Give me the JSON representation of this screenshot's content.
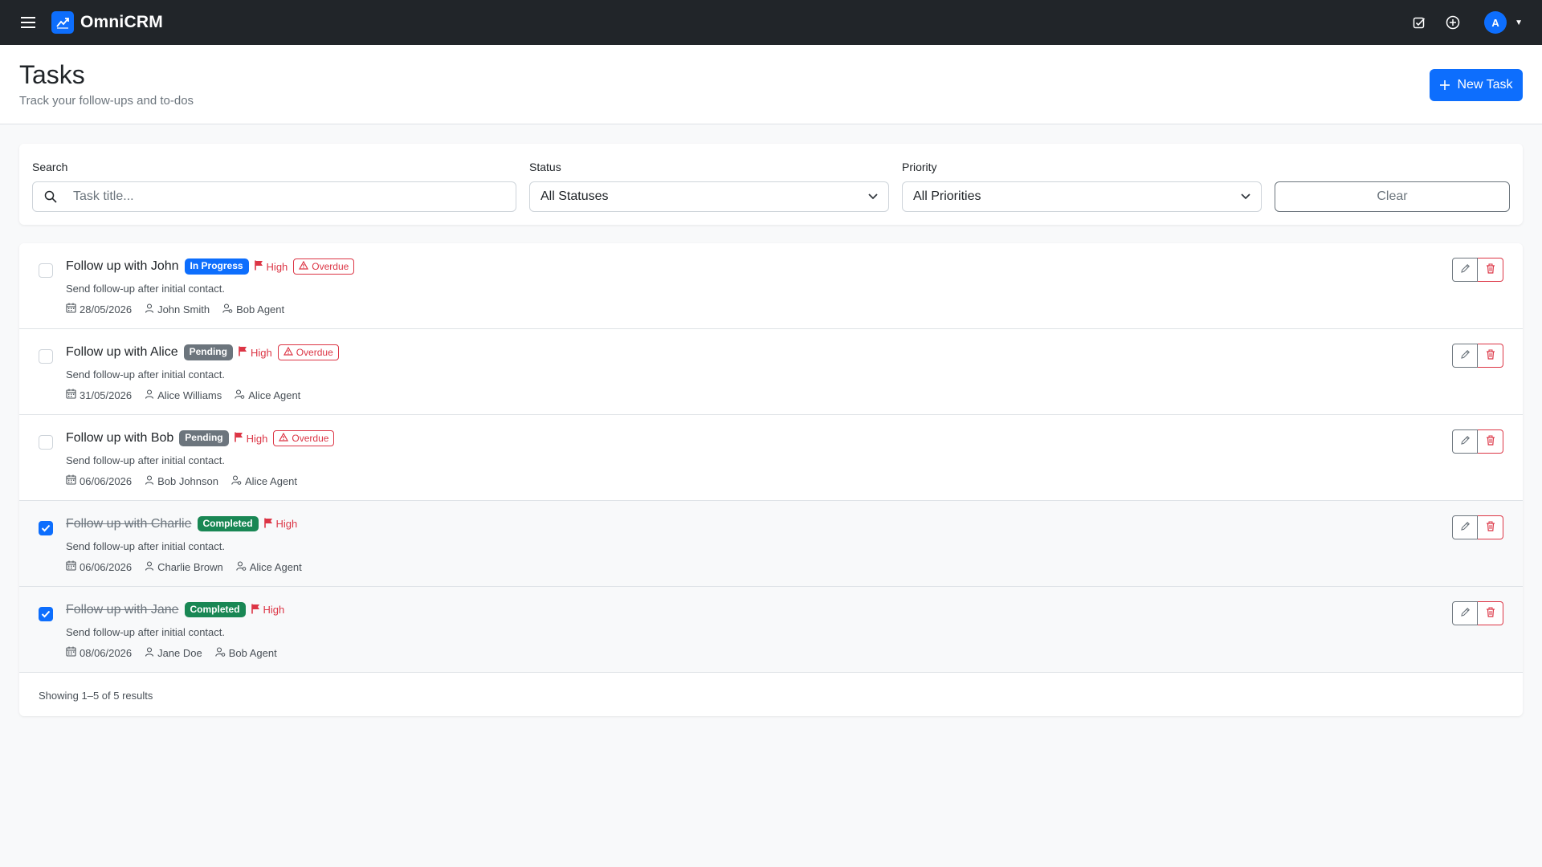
{
  "app": {
    "brand_name": "OmniCRM",
    "user_initial": "A",
    "icons": {
      "menu": "hamburger-icon",
      "logo": "trending-chart-icon",
      "tasks": "check-square-icon",
      "quick_add": "plus-circle-icon",
      "caret": "caret-down-icon"
    },
    "colors": {
      "navbar": "#212529",
      "primary": "#0d6efd",
      "danger": "#dc3545",
      "success": "#198754",
      "secondary": "#6c757d"
    }
  },
  "header": {
    "title": "Tasks",
    "subtitle": "Track your follow-ups and to-dos",
    "new_task_label": "New Task"
  },
  "filters": {
    "search_label": "Search",
    "search_placeholder": "Task title...",
    "status_label": "Status",
    "status_value": "All Statuses",
    "priority_label": "Priority",
    "priority_value": "All Priorities",
    "clear_label": "Clear"
  },
  "tasks": [
    {
      "title": "Follow up with John",
      "status": "In Progress",
      "status_color": "#0d6efd",
      "priority": "High",
      "overdue": "Overdue",
      "completed": false,
      "description": "Send follow-up after initial contact.",
      "due_date": "28/05/2026",
      "contact": "John Smith",
      "agent": "Bob Agent"
    },
    {
      "title": "Follow up with Alice",
      "status": "Pending",
      "status_color": "#6c757d",
      "priority": "High",
      "overdue": "Overdue",
      "completed": false,
      "description": "Send follow-up after initial contact.",
      "due_date": "31/05/2026",
      "contact": "Alice Williams",
      "agent": "Alice Agent"
    },
    {
      "title": "Follow up with Bob",
      "status": "Pending",
      "status_color": "#6c757d",
      "priority": "High",
      "overdue": "Overdue",
      "completed": false,
      "description": "Send follow-up after initial contact.",
      "due_date": "06/06/2026",
      "contact": "Bob Johnson",
      "agent": "Alice Agent"
    },
    {
      "title": "Follow up with Charlie",
      "status": "Completed",
      "status_color": "#198754",
      "priority": "High",
      "overdue": "",
      "completed": true,
      "description": "Send follow-up after initial contact.",
      "due_date": "06/06/2026",
      "contact": "Charlie Brown",
      "agent": "Alice Agent"
    },
    {
      "title": "Follow up with Jane",
      "status": "Completed",
      "status_color": "#198754",
      "priority": "High",
      "overdue": "",
      "completed": true,
      "description": "Send follow-up after initial contact.",
      "due_date": "08/06/2026",
      "contact": "Jane Doe",
      "agent": "Bob Agent"
    }
  ],
  "results_text": "Showing 1–5 of 5 results"
}
